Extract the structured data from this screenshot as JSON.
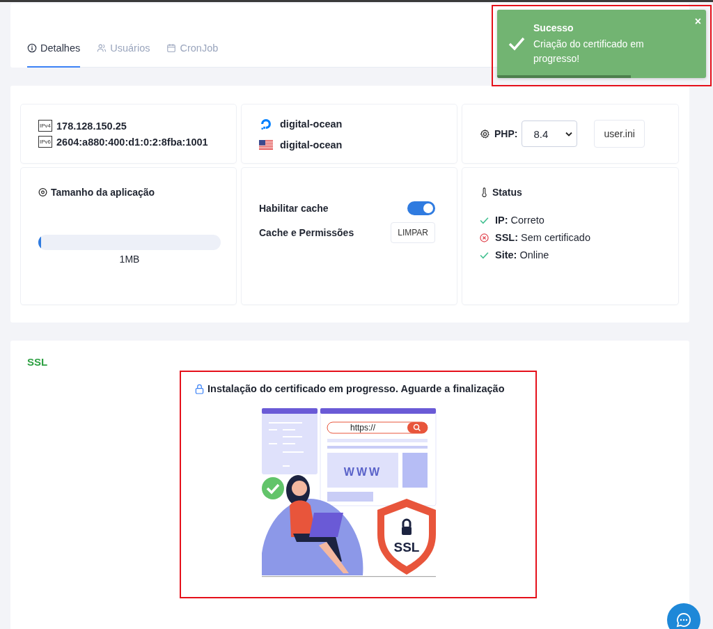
{
  "tabs": [
    {
      "label": "Detalhes",
      "kind": "info",
      "selected": true
    },
    {
      "label": "Usuários",
      "kind": "users",
      "selected": false
    },
    {
      "label": "CronJob",
      "kind": "calendar",
      "selected": false
    }
  ],
  "toast": {
    "title": "Sucesso",
    "message": "Criação do certificado em progresso!",
    "close": "×",
    "level": 0.64
  },
  "addresses": [
    {
      "badge": "IPv4",
      "value": "178.128.150.25"
    },
    {
      "badge": "IPv6",
      "value": "2604:a880:400:d1:0:2:8fba:1001"
    }
  ],
  "provider": [
    {
      "kind": "provider",
      "label": "digital-ocean"
    },
    {
      "kind": "region",
      "label": "digital-ocean"
    }
  ],
  "php": {
    "label": "PHP:",
    "version": "8.4",
    "button": "user.ini"
  },
  "app_size": {
    "title": "Tamanho da aplicação",
    "level": 0.01,
    "value": "1MB"
  },
  "cache": {
    "toggle_label": "Habilitar cache",
    "on": true,
    "clear_label": "Cache e Permissões",
    "clear_button": "LIMPAR"
  },
  "status": {
    "title": "Status",
    "items": [
      {
        "kind": "ok",
        "label": "IP:",
        "value": "Correto"
      },
      {
        "kind": "error",
        "label": "SSL:",
        "value": "Sem certificado"
      },
      {
        "kind": "ok",
        "label": "Site:",
        "value": "Online"
      }
    ]
  },
  "ssl": {
    "title": "SSL",
    "message": "Instalação do certificado em progresso. Aguarde a finalização",
    "illustration": {
      "url": "https://",
      "site": "WWW",
      "shield": "SSL"
    }
  }
}
